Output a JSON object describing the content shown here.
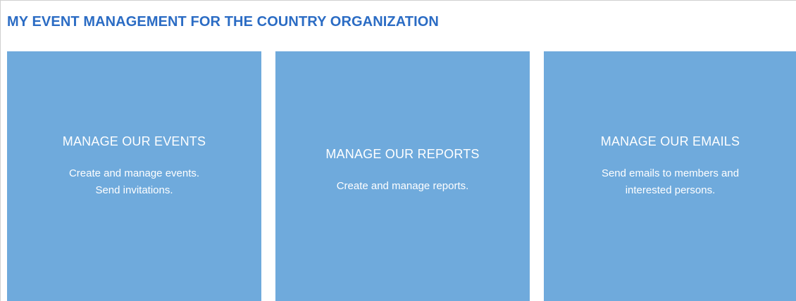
{
  "page": {
    "title": "MY EVENT MANAGEMENT FOR THE COUNTRY ORGANIZATION"
  },
  "colors": {
    "title": "#2b6cc4",
    "tile_background": "#6faadc",
    "tile_text": "#ffffff"
  },
  "tiles": [
    {
      "title": "MANAGE OUR EVENTS",
      "description_lines": [
        "Create and manage events.",
        "Send invitations."
      ]
    },
    {
      "title": "MANAGE OUR REPORTS",
      "description_lines": [
        "Create and manage reports."
      ]
    },
    {
      "title": "MANAGE OUR EMAILS",
      "description_lines": [
        "Send emails to members and",
        "interested persons."
      ]
    }
  ]
}
